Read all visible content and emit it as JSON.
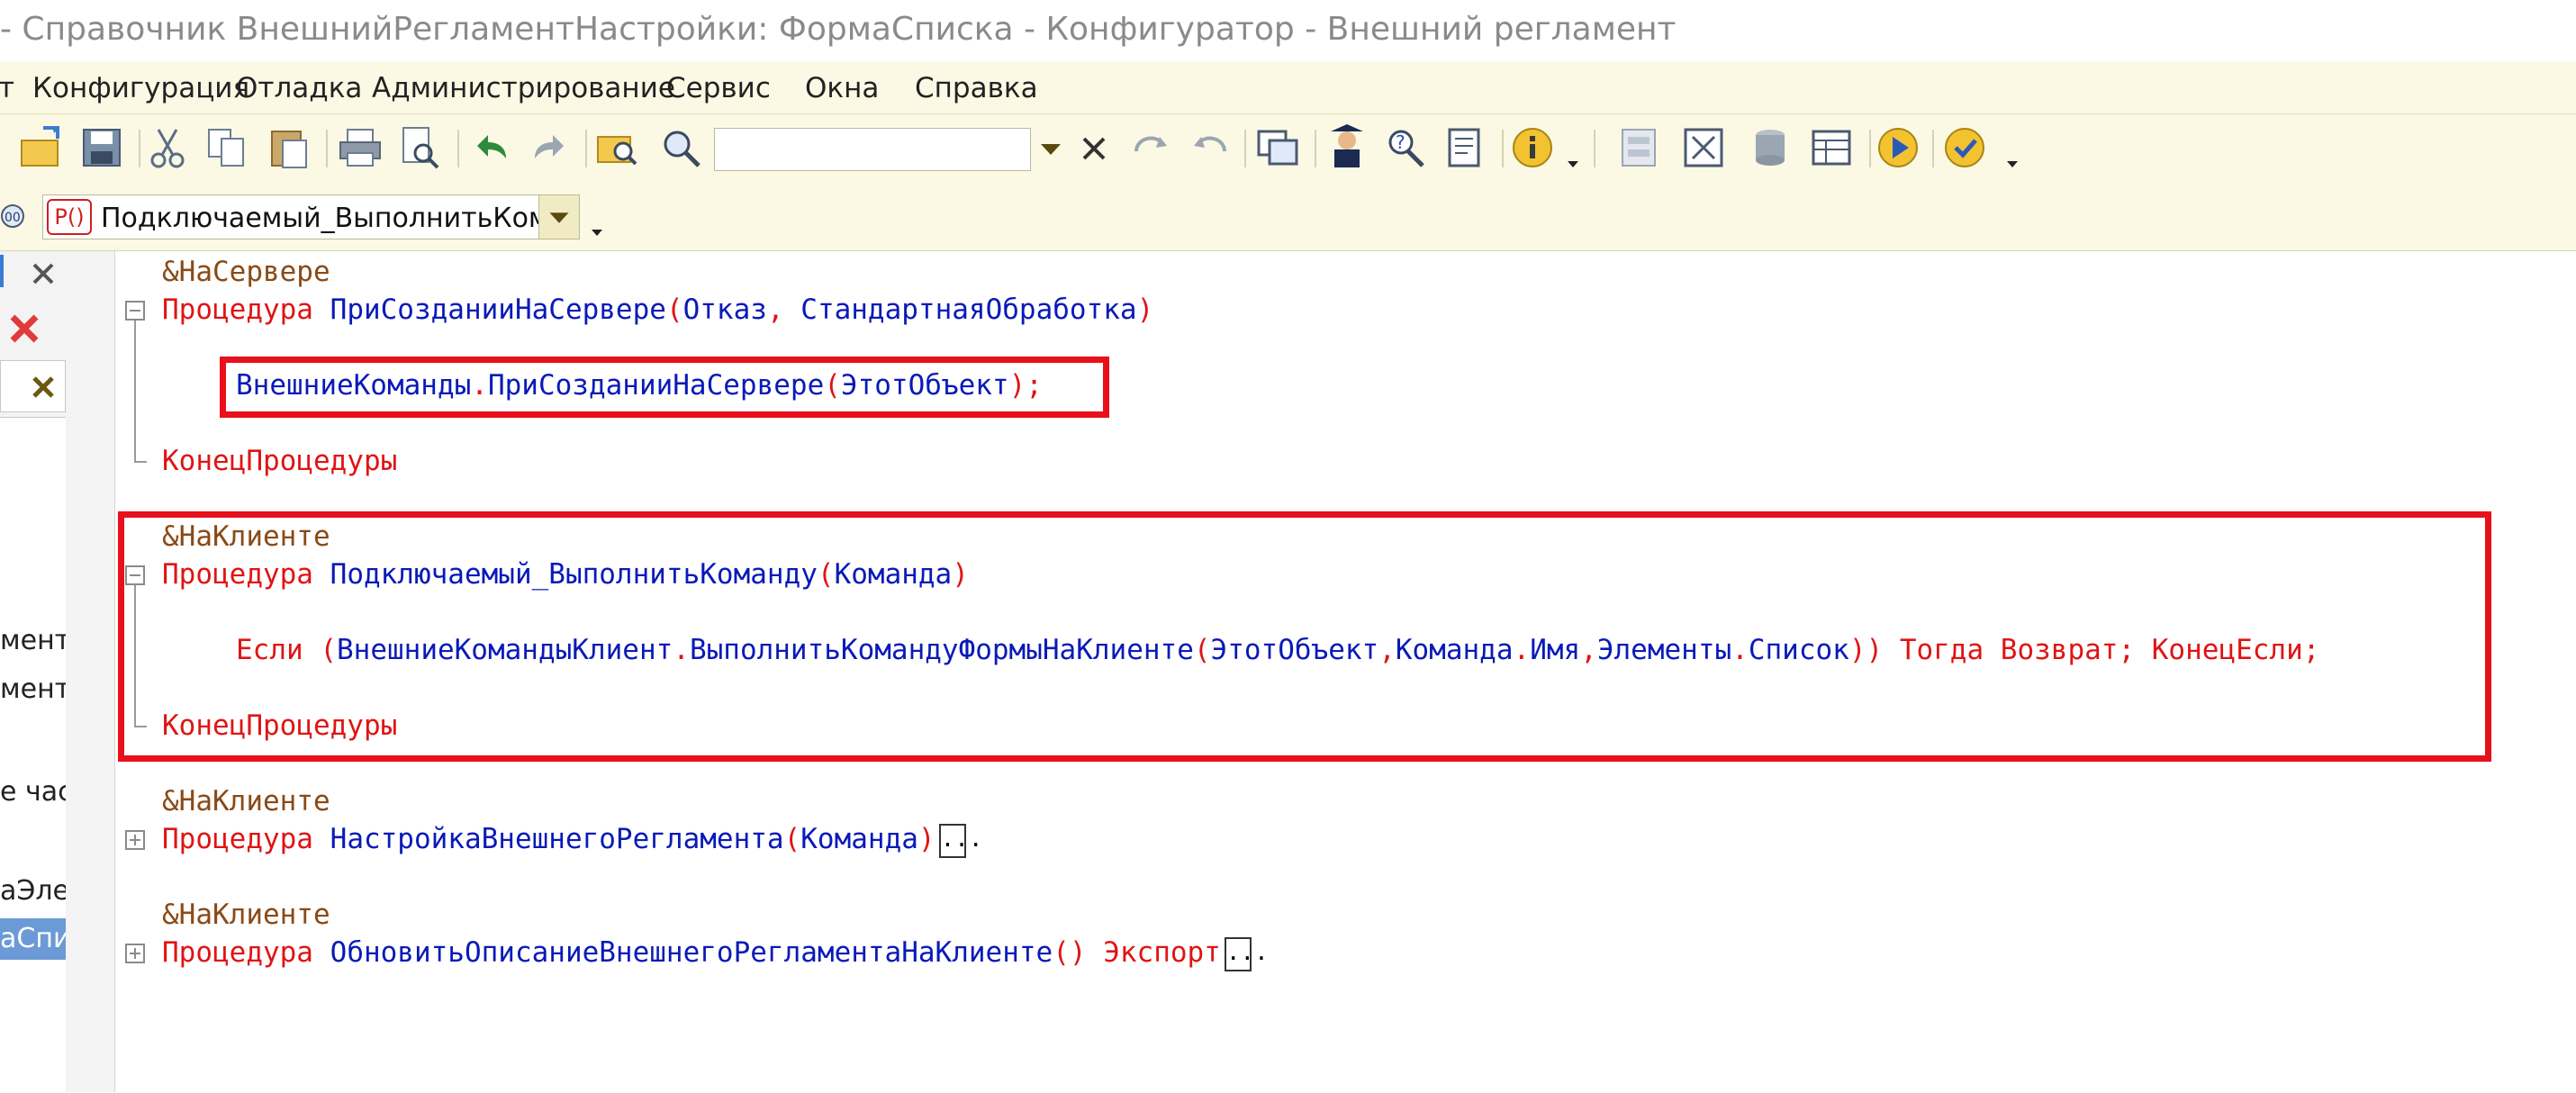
{
  "window": {
    "title": "- Справочник ВнешнийРегламентНастройки: ФормаСписка - Конфигуратор - Внешний регламент"
  },
  "menu": {
    "items": [
      "т",
      "Конфигурация",
      "Отладка",
      "Администрирование",
      "Сервис",
      "Окна",
      "Справка"
    ]
  },
  "toolbar": {
    "search_value": "",
    "icons": [
      "open-icon",
      "save-icon",
      "cut-icon",
      "copy-icon",
      "paste-icon",
      "print-icon",
      "print-preview-icon",
      "undo-icon",
      "redo-icon",
      "find-in-folder-icon",
      "find-icon",
      "search-dropdown-icon",
      "search-clear-icon",
      "find-next-icon",
      "find-prev-icon",
      "windows-icon",
      "wizard-icon",
      "syntax-helper-icon",
      "edit-module-icon",
      "info-icon",
      "config-icon",
      "compare-icon",
      "database-icon",
      "table-icon",
      "run-icon",
      "debug-icon"
    ]
  },
  "procedure_selector": {
    "icon_label": "P()",
    "value": "Подключаемый_ВыполнитьКоман,"
  },
  "left_panel": {
    "items": [
      "мент",
      "ментН",
      "е част",
      "аЭлем",
      "аСпис"
    ]
  },
  "code": {
    "line1": {
      "directive": "&НаСервере"
    },
    "line2": {
      "kw": "Процедура",
      "name": "ПриСозданииНаСервере",
      "open": "(",
      "p1": "Отказ",
      "comma": ",",
      "p2": "СтандартнаяОбработка",
      "close": ")"
    },
    "line3": {
      "obj": "ВнешниеКоманды",
      "dot": ".",
      "method": "ПриСозданииНаСервере",
      "open": "(",
      "arg": "ЭтотОбъект",
      "close": ");"
    },
    "line4": {
      "kw": "КонецПроцедуры"
    },
    "line5": {
      "directive": "&НаКлиенте"
    },
    "line6": {
      "kw": "Процедура",
      "name": "Подключаемый_ВыполнитьКоманду",
      "open": "(",
      "p1": "Команда",
      "close": ")"
    },
    "line7": {
      "kw_if": "Если",
      "open1": "(",
      "obj": "ВнешниеКомандыКлиент",
      "dot1": ".",
      "method": "ВыполнитьКомандуФормыНаКлиенте",
      "open2": "(",
      "a1": "ЭтотОбъект",
      "c1": ",",
      "a2": "Команда",
      "dot2": ".",
      "a2b": "Имя",
      "c2": ",",
      "a3": "Элементы",
      "dot3": ".",
      "a3b": "Список",
      "close": "))",
      "tail": " Тогда Возврат; КонецЕсли;"
    },
    "line8": {
      "kw": "КонецПроцедуры"
    },
    "line9": {
      "directive": "&НаКлиенте"
    },
    "line10": {
      "kw": "Процедура",
      "name": "НастройкаВнешнегоРегламента",
      "open": "(",
      "p1": "Команда",
      "close": ")",
      "collapsed": "..."
    },
    "line11": {
      "directive": "&НаКлиенте"
    },
    "line12": {
      "kw": "Процедура",
      "name": "ОбновитьОписаниеВнешнегоРегламентаНаКлиенте",
      "parens": "()",
      "export": "Экспорт",
      "collapsed": "..."
    }
  },
  "colors": {
    "keyword": "#e01414",
    "identifier": "#0a1ab8",
    "directive": "#8a4a16",
    "highlight": "#e8101a",
    "toolbar_bg": "#fbf9e4"
  }
}
